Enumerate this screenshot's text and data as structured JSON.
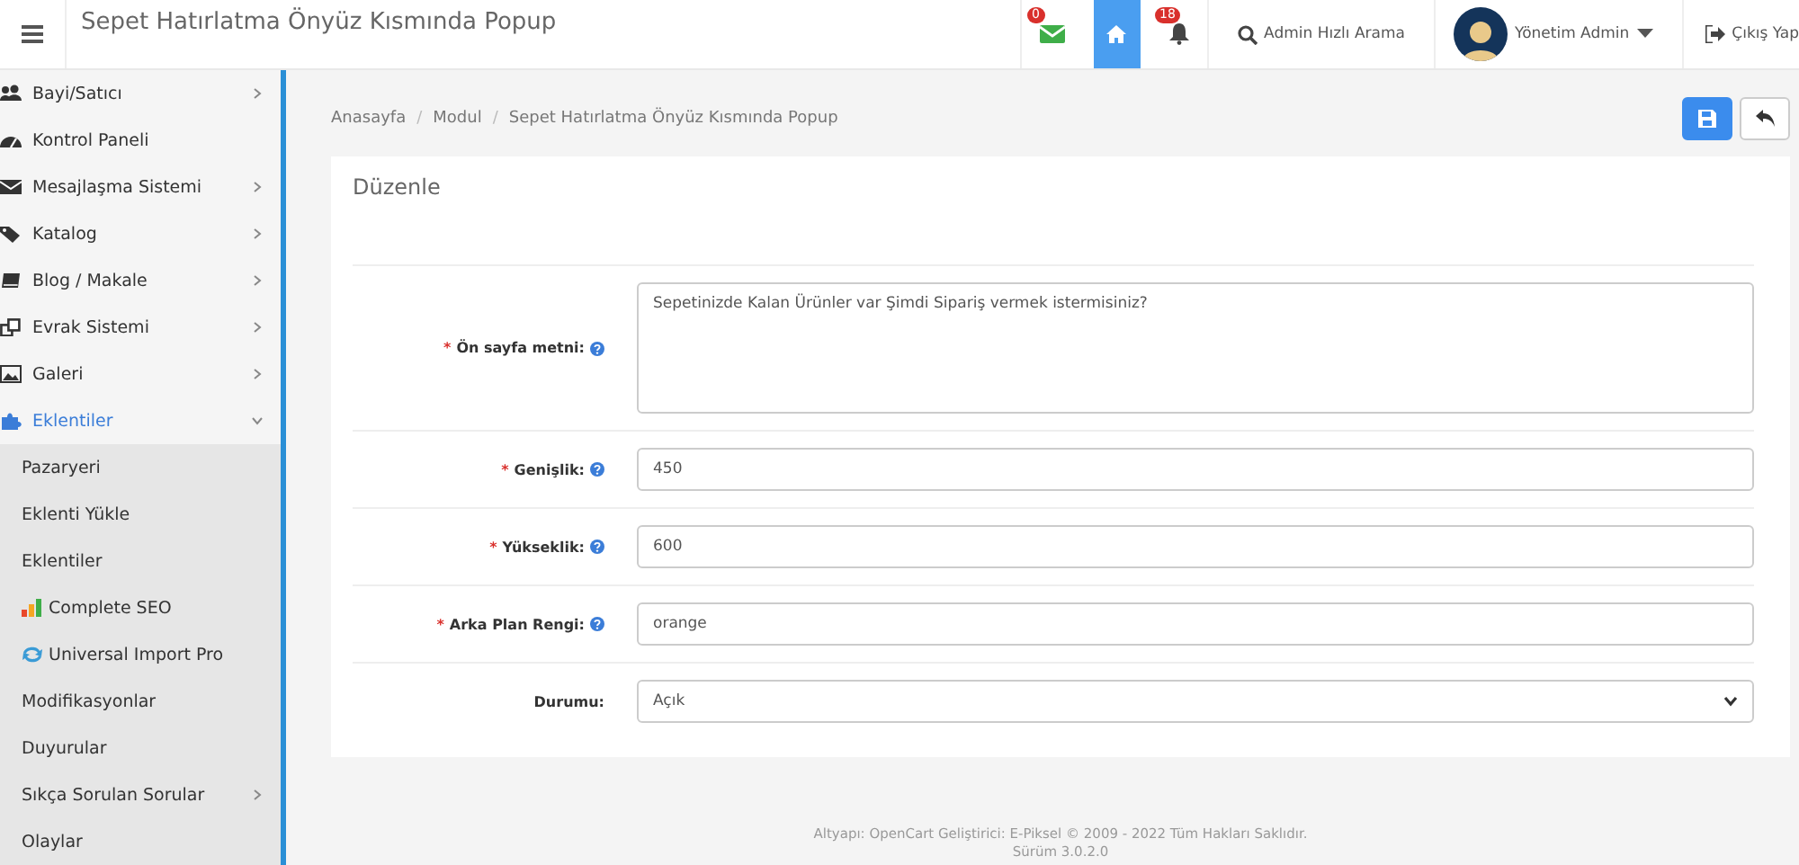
{
  "header": {
    "title": "Sepet Hatırlatma Önyüz Kısmında Popup",
    "mail_badge": "0",
    "notification_badge": "18",
    "search_label": "Admin Hızlı Arama",
    "user_name": "Yönetim Admin",
    "logout_label": "Çıkış Yap"
  },
  "sidebar": {
    "items": [
      {
        "label": "Bayi/Satıcı",
        "has_submenu": true,
        "expanded": false
      },
      {
        "label": "Kontrol Paneli",
        "has_submenu": false,
        "expanded": false
      },
      {
        "label": "Mesajlaşma Sistemi",
        "has_submenu": true,
        "expanded": false
      },
      {
        "label": "Katalog",
        "has_submenu": true,
        "expanded": false
      },
      {
        "label": "Blog / Makale",
        "has_submenu": true,
        "expanded": false
      },
      {
        "label": "Evrak Sistemi",
        "has_submenu": true,
        "expanded": false
      },
      {
        "label": "Galeri",
        "has_submenu": true,
        "expanded": false
      },
      {
        "label": "Eklentiler",
        "has_submenu": true,
        "expanded": true,
        "children": [
          {
            "label": "Pazaryeri",
            "has_submenu": false
          },
          {
            "label": "Eklenti Yükle",
            "has_submenu": false
          },
          {
            "label": "Eklentiler",
            "has_submenu": false
          },
          {
            "label": "Complete SEO",
            "has_submenu": false
          },
          {
            "label": "Universal Import Pro",
            "has_submenu": false
          },
          {
            "label": "Modifikasyonlar",
            "has_submenu": false
          },
          {
            "label": "Duyurular",
            "has_submenu": false
          },
          {
            "label": "Sıkça Sorulan Sorular",
            "has_submenu": true
          },
          {
            "label": "Olaylar",
            "has_submenu": false
          }
        ]
      }
    ]
  },
  "breadcrumb": [
    {
      "label": "Anasayfa"
    },
    {
      "separator": "/",
      "label": "Modul"
    },
    {
      "separator": "/",
      "label": "Sepet Hatırlatma Önyüz Kısmında Popup"
    }
  ],
  "panel": {
    "title": "Düzenle",
    "fields": [
      {
        "kind": "textarea",
        "marker": "*",
        "label": "Ön sayfa metni:",
        "help": true,
        "value": "Sepetinizde Kalan Ürünler var Şimdi Sipariş vermek istermisiniz?"
      },
      {
        "kind": "input",
        "marker": "*",
        "label": "Genişlik:",
        "help": true,
        "value": "450"
      },
      {
        "kind": "input",
        "marker": "*",
        "label": "Yükseklik:",
        "help": true,
        "value": "600"
      },
      {
        "kind": "input",
        "marker": "*",
        "label": "Arka Plan Rengi:",
        "help": true,
        "value": "orange"
      },
      {
        "kind": "select",
        "label": "Durumu:",
        "help": false,
        "value": "Açık"
      }
    ]
  },
  "footer": [
    "Altyapı: OpenCart Geliştirici: E-Piksel © 2009 - 2022 Tüm Hakları Saklıdır.",
    "Sürüm 3.0.2.0"
  ]
}
